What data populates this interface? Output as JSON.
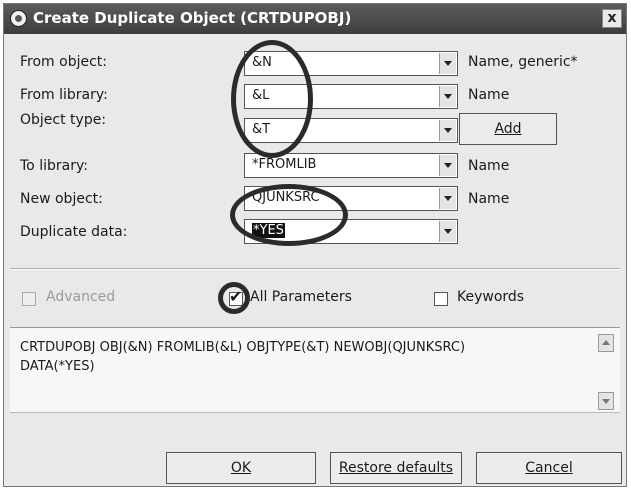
{
  "dialog": {
    "title": "Create Duplicate Object (CRTDUPOBJ)",
    "close_label": "x"
  },
  "fields": [
    {
      "label": "From object:",
      "value": "&N",
      "hint": "Name, generic*"
    },
    {
      "label": "From library:",
      "value": "&L",
      "hint": "Name"
    },
    {
      "label": "Object type:",
      "value": "&T",
      "hint": ""
    },
    {
      "label": "To library:",
      "value": "*FROMLIB",
      "hint": "Name"
    },
    {
      "label": "New object:",
      "value": "QJUNKSRC",
      "hint": "Name"
    },
    {
      "label": "Duplicate data:",
      "value": "*YES",
      "hint": ""
    }
  ],
  "add_button": {
    "label": "Add"
  },
  "options": {
    "advanced": {
      "label": "Advanced",
      "checked": false,
      "enabled": false
    },
    "all_parameters": {
      "label": "All Parameters",
      "checked": true
    },
    "keywords": {
      "label": "Keywords",
      "checked": false
    }
  },
  "command": {
    "line1": "CRTDUPOBJ OBJ(&N) FROMLIB(&L) OBJTYPE(&T) NEWOBJ(QJUNKSRC)",
    "line2": "DATA(*YES)"
  },
  "buttons": {
    "ok": "OK",
    "restore": "Restore defaults",
    "cancel": "Cancel"
  }
}
